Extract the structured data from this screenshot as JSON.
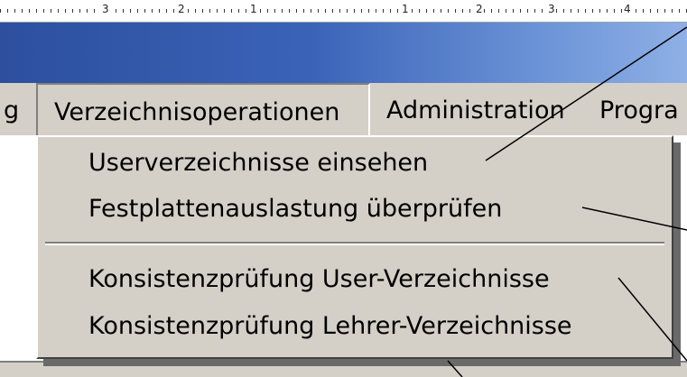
{
  "ruler": {
    "numbers": [
      "3",
      "2",
      "1",
      "1",
      "2",
      "3",
      "4"
    ]
  },
  "menubar": {
    "items": [
      {
        "label": "g"
      },
      {
        "label": "Verzeichnisoperationen"
      },
      {
        "label": "Administration"
      },
      {
        "label": "Progra"
      }
    ]
  },
  "dropdown": {
    "items": [
      {
        "label": "Userverzeichnisse einsehen"
      },
      {
        "label": "Festplattenauslastung überprüfen"
      },
      {
        "label": "Konsistenzprüfung User-Verzeichnisse"
      },
      {
        "label": "Konsistenzprüfung Lehrer-Verzeichnisse"
      }
    ]
  },
  "colors": {
    "slide_background": "#4b4be0",
    "menu_background": "#d4d0c8",
    "title_bar_gradient": [
      "#2d4f9e",
      "#8fb0e6"
    ],
    "annotation_lines": "#000000"
  }
}
